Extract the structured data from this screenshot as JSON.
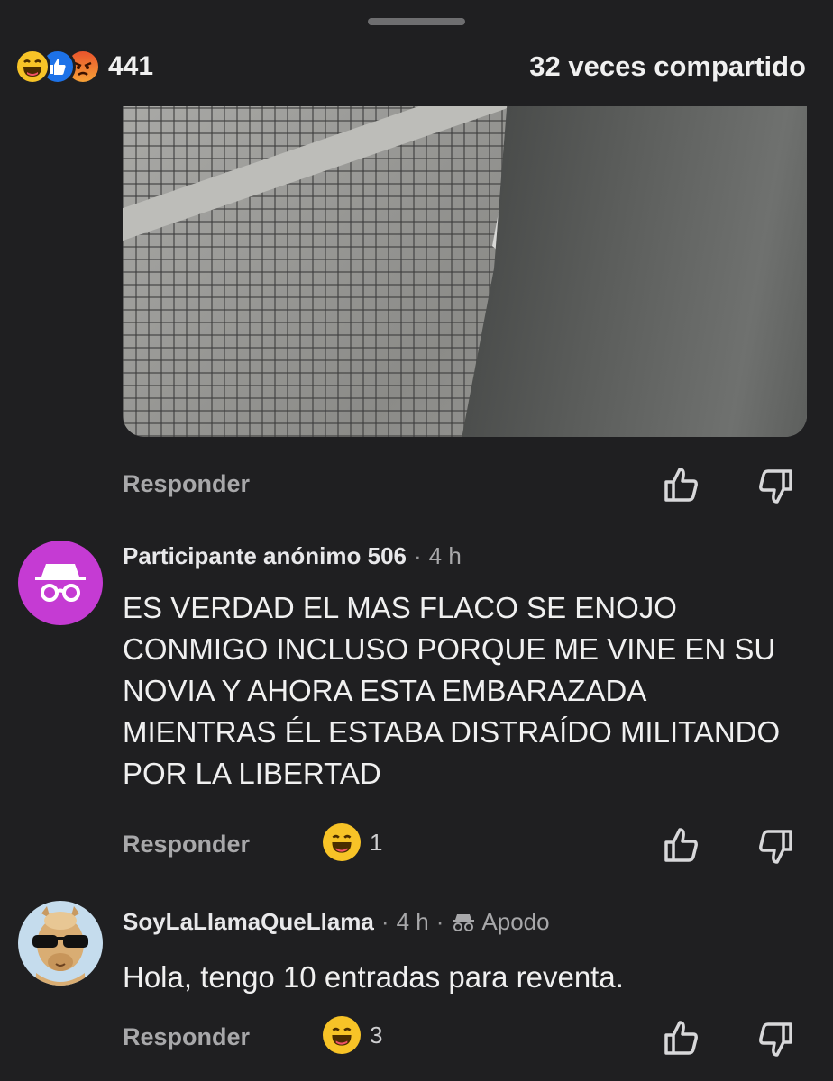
{
  "summary": {
    "reaction_count": "441",
    "shares": "32 veces compartido",
    "reaction_icons": [
      "haha-icon",
      "like-icon",
      "angry-icon"
    ]
  },
  "photo": {
    "description_hidden": true
  },
  "actions": {
    "reply_label": "Responder"
  },
  "comments": [
    {
      "author": "Participante anónimo 506",
      "time": "4 h",
      "text": "ES VERDAD EL MAS FLACO SE ENOJO CONMIGO INCLUSO PORQUE ME VINE EN SU NOVIA Y AHORA ESTA EMBARAZADA MIENTRAS ÉL ESTABA DISTRAÍDO MILITANDO POR LA LIBERTAD",
      "reaction_count": "1",
      "avatar": "anonymous-incognito-icon"
    },
    {
      "author": "SoyLaLlamaQueLlama",
      "time": "4 h",
      "badge": "Apodo",
      "text": "Hola, tengo 10 entradas para reventa.",
      "reaction_count": "3",
      "avatar": "llama-sunglasses-avatar"
    }
  ],
  "colors": {
    "background": "#1f1f21",
    "anon_avatar": "#c53bd3",
    "haha": "#f7c327",
    "like": "#1d72e8",
    "angry": "#e9542c"
  }
}
